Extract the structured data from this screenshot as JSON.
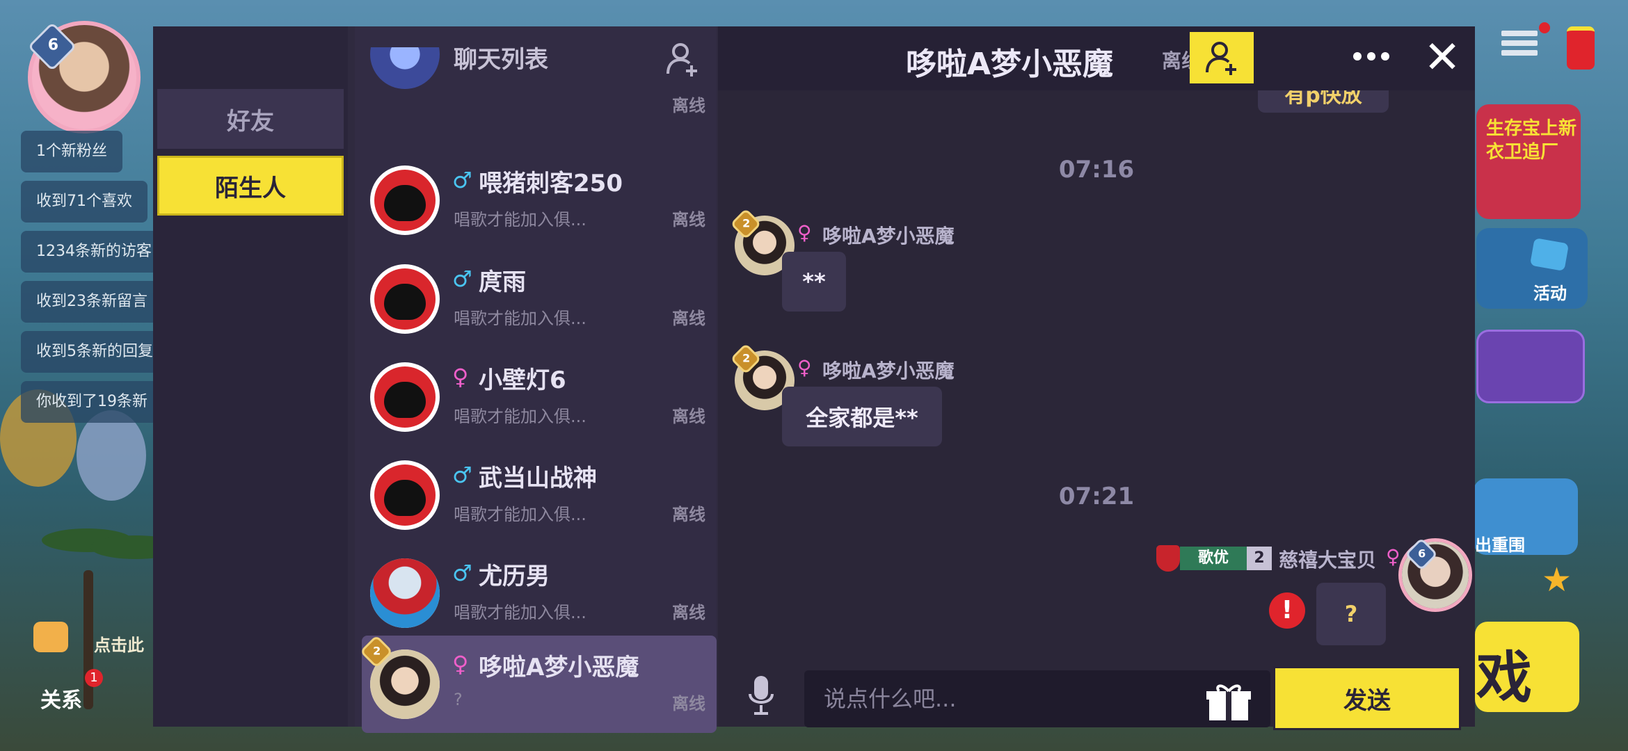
{
  "background": {
    "player_level": "6",
    "notifications": [
      "1个新粉丝",
      "收到71个喜欢",
      "1234条新的访客",
      "收到23条新留言",
      "收到5条新的回复",
      "你收到了19条新"
    ],
    "relations_label": "关系",
    "relations_badge": "1",
    "click_hint": "点击此",
    "activity_label": "活动",
    "banner_text": "生存宝上新 衣卫追厂",
    "escape_label": "出重围",
    "game_label": "戏"
  },
  "categories": {
    "friends": "好友",
    "strangers": "陌生人"
  },
  "chat_list": {
    "title": "聊天列表",
    "contacts": [
      {
        "name": "",
        "preview": "",
        "status": "离线",
        "gender": ""
      },
      {
        "name": "喂猪刺客250",
        "preview": "唱歌才能加入俱...",
        "status": "离线",
        "gender": "♂"
      },
      {
        "name": "庹雨",
        "preview": "唱歌才能加入俱...",
        "status": "离线",
        "gender": "♂"
      },
      {
        "name": "小壁灯6",
        "preview": "唱歌才能加入俱...",
        "status": "离线",
        "gender": "♀"
      },
      {
        "name": "武当山战神",
        "preview": "唱歌才能加入俱...",
        "status": "离线",
        "gender": "♂"
      },
      {
        "name": "尤历男",
        "preview": "唱歌才能加入俱...",
        "status": "离线",
        "gender": "♂"
      },
      {
        "name": "哆啦A梦小恶魔",
        "preview": "?",
        "status": "离线",
        "gender": "♀",
        "level": "2"
      }
    ]
  },
  "chat": {
    "title": "哆啦A梦小恶魔",
    "status": "离线",
    "partial_top_message": "有p快放",
    "messages": [
      {
        "time": "07:16",
        "sender": "哆啦A梦小恶魔",
        "gender": "♀",
        "level": "2",
        "text": "**"
      },
      {
        "sender": "哆啦A梦小恶魔",
        "gender": "♀",
        "level": "2",
        "text": "全家都是**"
      },
      {
        "time": "07:21",
        "self": true,
        "title_badge": "歌优",
        "title_level": "2",
        "sender": "慈禧大宝贝",
        "gender": "♀",
        "level": "6",
        "text": "?",
        "failed_icon": "!"
      }
    ],
    "input_placeholder": "说点什么吧...",
    "send_label": "发送"
  },
  "colors": {
    "accent_yellow": "#f7e135",
    "male_blue": "#4ac4f0",
    "female_pink": "#ee5fc9",
    "error_red": "#e0242c",
    "panel_bg": "#2f2a3f"
  }
}
